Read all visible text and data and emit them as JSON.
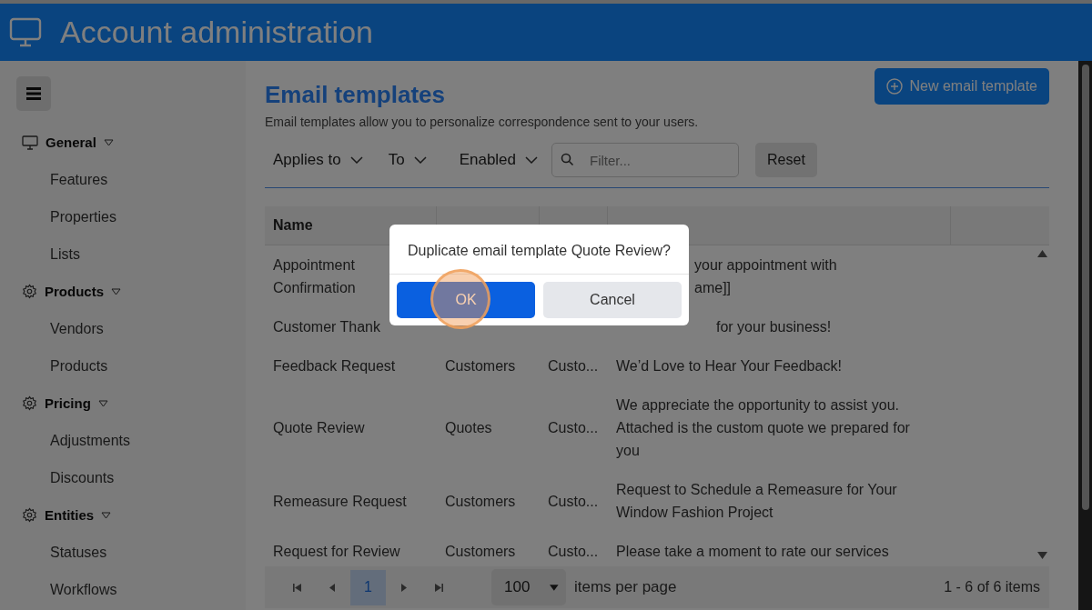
{
  "header": {
    "title": "Account administration"
  },
  "sidebar": {
    "groups": [
      {
        "label": "General",
        "kind": "monitor",
        "expanded": true,
        "items": [
          "Features",
          "Properties",
          "Lists"
        ]
      },
      {
        "label": "Products",
        "kind": "gear",
        "expanded": true,
        "items": [
          "Vendors",
          "Products"
        ]
      },
      {
        "label": "Pricing",
        "kind": "gear",
        "expanded": true,
        "items": [
          "Adjustments",
          "Discounts"
        ]
      },
      {
        "label": "Entities",
        "kind": "gear",
        "expanded": true,
        "items": [
          "Statuses",
          "Workflows"
        ]
      }
    ]
  },
  "page": {
    "title": "Email templates",
    "description": "Email templates allow you to personalize correspondence sent to your users.",
    "new_button": "New email template",
    "filters": [
      "Applies to",
      "To",
      "Enabled"
    ],
    "filter_placeholder": "Filter...",
    "reset_button": "Reset"
  },
  "table": {
    "columns": [
      "Name"
    ],
    "rows": [
      {
        "name": "Appointment Confirmation",
        "subject": [
          "your appointment with",
          "ame]]"
        ]
      },
      {
        "name": "Customer Thank",
        "subject": [
          "for your business!"
        ]
      },
      {
        "name": "Feedback Request",
        "applies_to": "Customers",
        "to": "Custo...",
        "subject": [
          "We’d Love to Hear Your Feedback!"
        ]
      },
      {
        "name": "Quote Review",
        "applies_to": "Quotes",
        "to": "Custo...",
        "subject": [
          "We appreciate the opportunity to assist you. Attached is the custom quote we prepared for you"
        ]
      },
      {
        "name": "Remeasure Request",
        "applies_to": "Customers",
        "to": "Custo...",
        "subject": [
          "Request to Schedule a Remeasure for Your Window Fashion Project"
        ]
      },
      {
        "name": "Request for Review",
        "applies_to": "Customers",
        "to": "Custo...",
        "subject": [
          "Please take a moment to rate our services"
        ]
      }
    ]
  },
  "pager": {
    "pages": [
      {
        "label": "1",
        "selected": true
      }
    ],
    "page_size": "100",
    "page_size_label": "items per page",
    "summary": "1 - 6 of 6 items"
  },
  "dialog": {
    "message": "Duplicate email template Quote Review?",
    "ok_button": "OK",
    "cancel_button": "Cancel"
  }
}
